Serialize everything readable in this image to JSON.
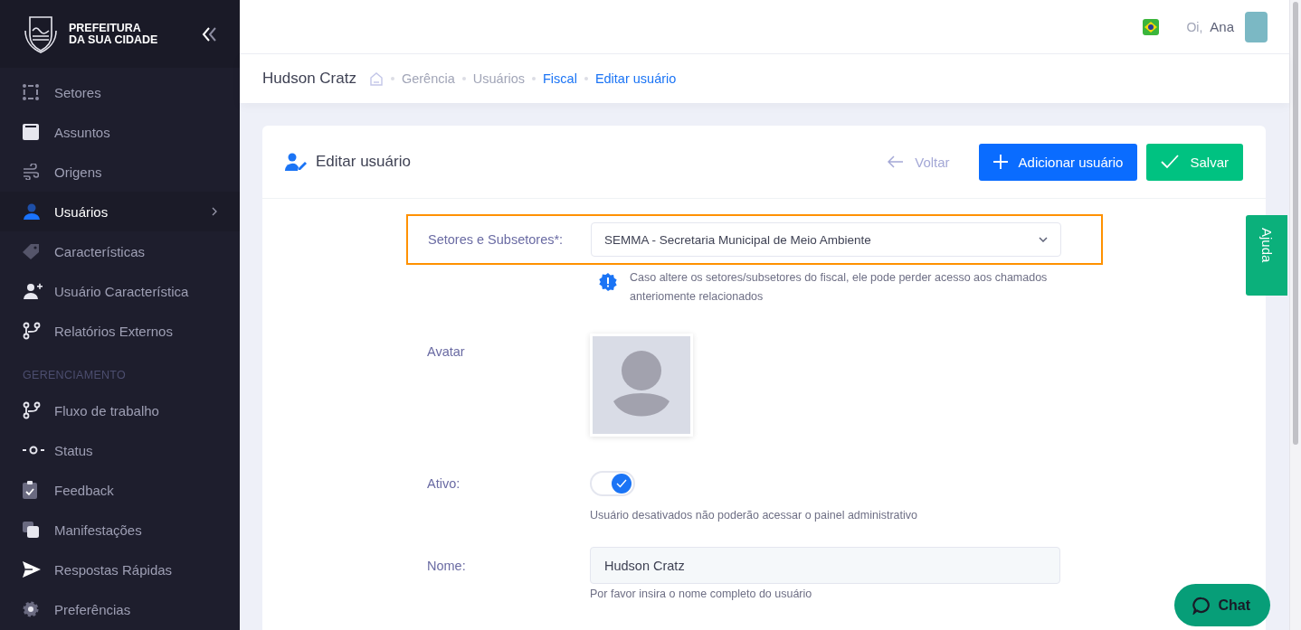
{
  "sidebar": {
    "logo": {
      "line1": "PREFEITURA",
      "line2": "DA SUA CIDADE"
    },
    "items": [
      {
        "label": "Setores",
        "selected": false
      },
      {
        "label": "Assuntos",
        "selected": false
      },
      {
        "label": "Origens",
        "selected": false
      },
      {
        "label": "Usuários",
        "selected": true
      },
      {
        "label": "Características",
        "selected": false
      },
      {
        "label": "Usuário Característica",
        "selected": false
      },
      {
        "label": "Relatórios Externos",
        "selected": false
      }
    ],
    "section_heading": "GERENCIAMENTO",
    "section_items": [
      {
        "label": "Fluxo de trabalho",
        "selected": false
      },
      {
        "label": "Status",
        "selected": false
      },
      {
        "label": "Feedback",
        "selected": false
      },
      {
        "label": "Manifestações",
        "selected": false
      },
      {
        "label": "Respostas Rápidas",
        "selected": false
      },
      {
        "label": "Preferências",
        "selected": false
      }
    ]
  },
  "top_bar": {
    "greeting": "Oi,",
    "user_name": "Ana"
  },
  "page_header": {
    "title": "Hudson Cratz",
    "breadcrumbs": [
      {
        "label": "Gerência",
        "current": false
      },
      {
        "label": "Usuários",
        "current": false
      },
      {
        "label": "Fiscal",
        "current": true
      },
      {
        "label": "Editar usuário",
        "current": true
      }
    ]
  },
  "card": {
    "title": "Editar usuário",
    "back_label": "Voltar",
    "add_label": "Adicionar usuário",
    "save_label": "Salvar",
    "fields": [
      {
        "kind": "select",
        "label": "Setores e Subsetores*:",
        "value": "SEMMA - Secretaria Municipal de Meio Ambiente",
        "highlighted": true,
        "notice": "Caso altere os setores/subsetores do fiscal, ele pode perder acesso aos chamados anteriomente relacionados"
      },
      {
        "kind": "avatar",
        "label": "Avatar"
      },
      {
        "kind": "toggle",
        "label": "Ativo:",
        "on": true,
        "hint": "Usuário desativados não poderão acessar o painel administrativo"
      },
      {
        "kind": "text",
        "label": "Nome:",
        "value": "Hudson Cratz",
        "hint": "Por favor insira o nome completo do usuário"
      }
    ]
  },
  "help_tab": "Ajuda",
  "chat_button": "Chat"
}
